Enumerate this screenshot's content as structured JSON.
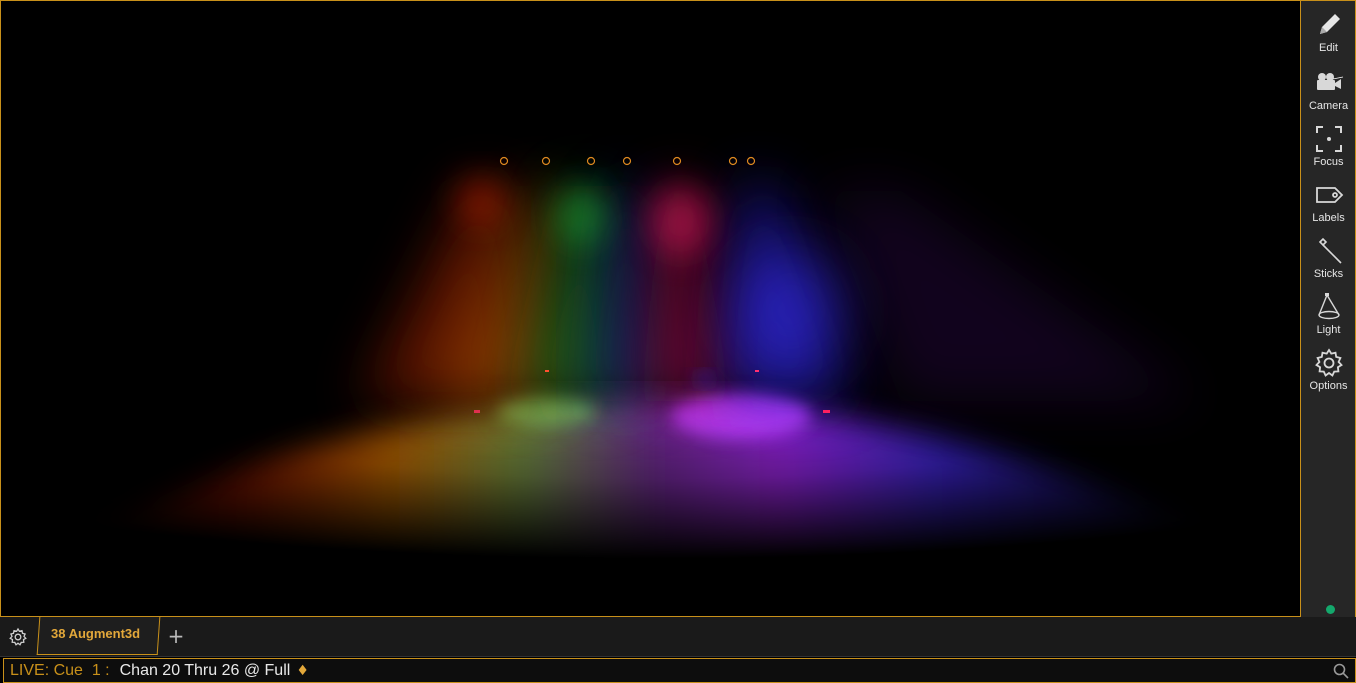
{
  "toolbar": {
    "items": [
      {
        "label": "Edit",
        "icon": "pencil-icon"
      },
      {
        "label": "Camera",
        "icon": "camera-icon"
      },
      {
        "label": "Focus",
        "icon": "focus-icon"
      },
      {
        "label": "Labels",
        "icon": "tag-icon"
      },
      {
        "label": "Sticks",
        "icon": "stick-icon"
      },
      {
        "label": "Light",
        "icon": "cone-light-icon"
      },
      {
        "label": "Options",
        "icon": "gear-icon"
      }
    ],
    "status_color": "#14a86c"
  },
  "tabs": {
    "active_label": "38 Augment3d",
    "add_symbol": "+"
  },
  "command_line": {
    "prefix": "LIVE: Cue  1 :",
    "text": "Chan 20 Thru 26 @ Full",
    "terminator": "♦"
  },
  "colors": {
    "accent": "#c8901a",
    "status_green": "#14a86c",
    "beam_colors": [
      "#ff3a00",
      "#ffa000",
      "#1fbf2a",
      "#2a3cff",
      "#ff1a55",
      "#3a2bff",
      "#6b1fff"
    ]
  }
}
